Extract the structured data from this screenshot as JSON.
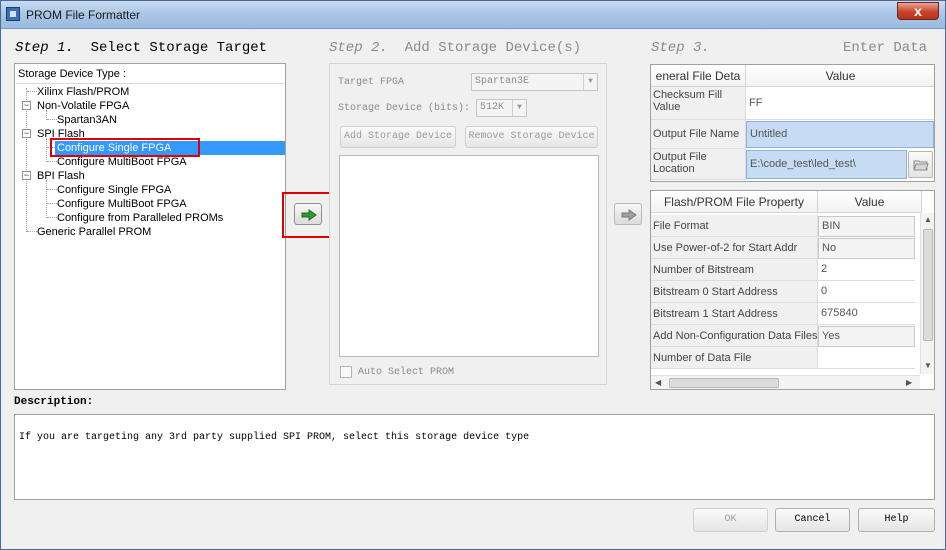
{
  "window": {
    "title": "PROM File Formatter",
    "close_glyph": "x"
  },
  "steps": {
    "step1": {
      "num": "Step 1.",
      "label": "Select Storage Target"
    },
    "step2": {
      "num": "Step 2.",
      "label": "Add Storage Device(s)"
    },
    "step3": {
      "num": "Step 3.",
      "label": "Enter Data"
    }
  },
  "tree": {
    "title": "Storage Device Type :",
    "items": [
      "Xilinx Flash/PROM",
      "Non-Volatile FPGA",
      "Spartan3AN",
      "SPI Flash",
      "Configure Single FPGA",
      "Configure MultiBoot FPGA",
      "BPI Flash",
      "Configure Single FPGA",
      "Configure MultiBoot FPGA",
      "Configure from Paralleled PROMs",
      "Generic Parallel PROM"
    ]
  },
  "step2": {
    "target_fpga_label": "Target FPGA",
    "target_fpga_value": "Spartan3E",
    "storage_device_label": "Storage Device (bits):",
    "storage_device_value": "512K",
    "add_button": "Add Storage Device",
    "remove_button": "Remove Storage Device",
    "auto_select_label": "Auto Select PROM"
  },
  "general_grid": {
    "headers": [
      "eneral File Deta",
      "Value"
    ],
    "rows": [
      {
        "key": "Checksum Fill Value",
        "value": "FF"
      },
      {
        "key": "Output File Name",
        "value": "Untitled"
      },
      {
        "key": "Output File Location",
        "value": "E:\\code_test\\led_test\\"
      }
    ]
  },
  "property_grid": {
    "headers": [
      "Flash/PROM File Property",
      "Value"
    ],
    "rows": [
      {
        "key": "File Format",
        "value": "BIN"
      },
      {
        "key": "Use Power-of-2 for Start Addr",
        "value": "No"
      },
      {
        "key": "Number of Bitstream",
        "value": "2"
      },
      {
        "key": "Bitstream 0 Start Address",
        "value": "0"
      },
      {
        "key": "Bitstream 1 Start Address",
        "value": "675840"
      },
      {
        "key": "Add Non-Configuration Data Files",
        "value": "Yes"
      },
      {
        "key": "Number of Data File",
        "value": ""
      }
    ]
  },
  "description": {
    "label": "Description:",
    "text": "If you are targeting any 3rd party supplied SPI PROM, select this storage device type"
  },
  "buttons": {
    "ok": "OK",
    "cancel": "Cancel",
    "help": "Help"
  },
  "colors": {
    "selection": "#3399ff",
    "highlight_border": "#e00000",
    "arrow_green": "#2f9b2f"
  },
  "icons": [
    "app-icon",
    "close-icon",
    "green-arrow-icon",
    "gray-arrow-icon",
    "folder-icon"
  ]
}
